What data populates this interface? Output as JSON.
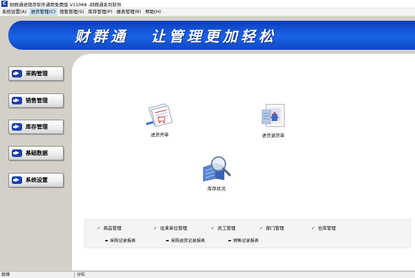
{
  "window": {
    "title": "财群通进销存软件通用免费版 V11068 -财群通系列软件"
  },
  "menu": [
    {
      "label": "系统设置(A)"
    },
    {
      "label": "进货管理(C)"
    },
    {
      "label": "销售管理(S)"
    },
    {
      "label": "库存管理(P)"
    },
    {
      "label": "报表管理(R)"
    },
    {
      "label": "帮助(H)"
    }
  ],
  "banner": {
    "brand": "财群通",
    "slogan": "让管理更加轻松"
  },
  "sidebar": [
    {
      "label": "采购管理"
    },
    {
      "label": "销售管理"
    },
    {
      "label": "库存管理"
    },
    {
      "label": "基础数据"
    },
    {
      "label": "系统设置"
    }
  ],
  "functions": {
    "purchase_order": "进货开单",
    "purchase_return": "进货退货单",
    "stock_status": "库存状况"
  },
  "quick_links": [
    {
      "label": "商品管理"
    },
    {
      "label": "往来单位管理"
    },
    {
      "label": "员工管理"
    },
    {
      "label": "部门管理"
    },
    {
      "label": "仓库管理"
    }
  ],
  "reports": [
    {
      "label": "采购记录报表"
    },
    {
      "label": "采购退货记录报表"
    },
    {
      "label": "销售记录报表"
    }
  ],
  "statusbar": {
    "left": "就绪",
    "right": "分栏"
  },
  "colors": {
    "banner_blue": "#1656d8",
    "nav_arrow": "#1c40b0",
    "app_background": "#d4d0c8"
  },
  "icons": [
    "app-logo-icon",
    "arrow-right-icon",
    "document-cart-icon",
    "document-return-icon",
    "magnifier-building-icon",
    "checkmark-icon"
  ]
}
